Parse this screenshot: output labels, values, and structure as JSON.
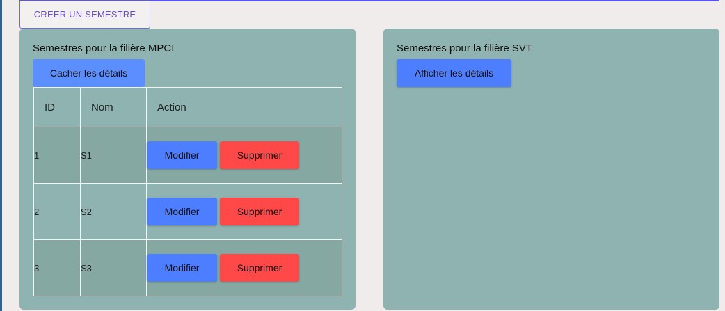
{
  "toolbar": {
    "create_label": "CREER UN SEMESTRE"
  },
  "cards": [
    {
      "title": "Semestres pour la filière MPCI",
      "toggle_label": "Cacher les détails",
      "table": {
        "headers": [
          "ID",
          "Nom",
          "Action"
        ],
        "rows": [
          {
            "id": "1",
            "nom": "S1"
          },
          {
            "id": "2",
            "nom": "S2"
          },
          {
            "id": "3",
            "nom": "S3"
          }
        ]
      },
      "edit_label": "Modifier",
      "delete_label": "Supprimer"
    },
    {
      "title": "Semestres pour la filière SVT",
      "toggle_label": "Afficher les détails"
    }
  ],
  "colors": {
    "card_bg": "#8fb3b0",
    "primary_button": "#4d7eff",
    "danger_button": "#ff4848",
    "accent_outline": "#7b68d8"
  }
}
